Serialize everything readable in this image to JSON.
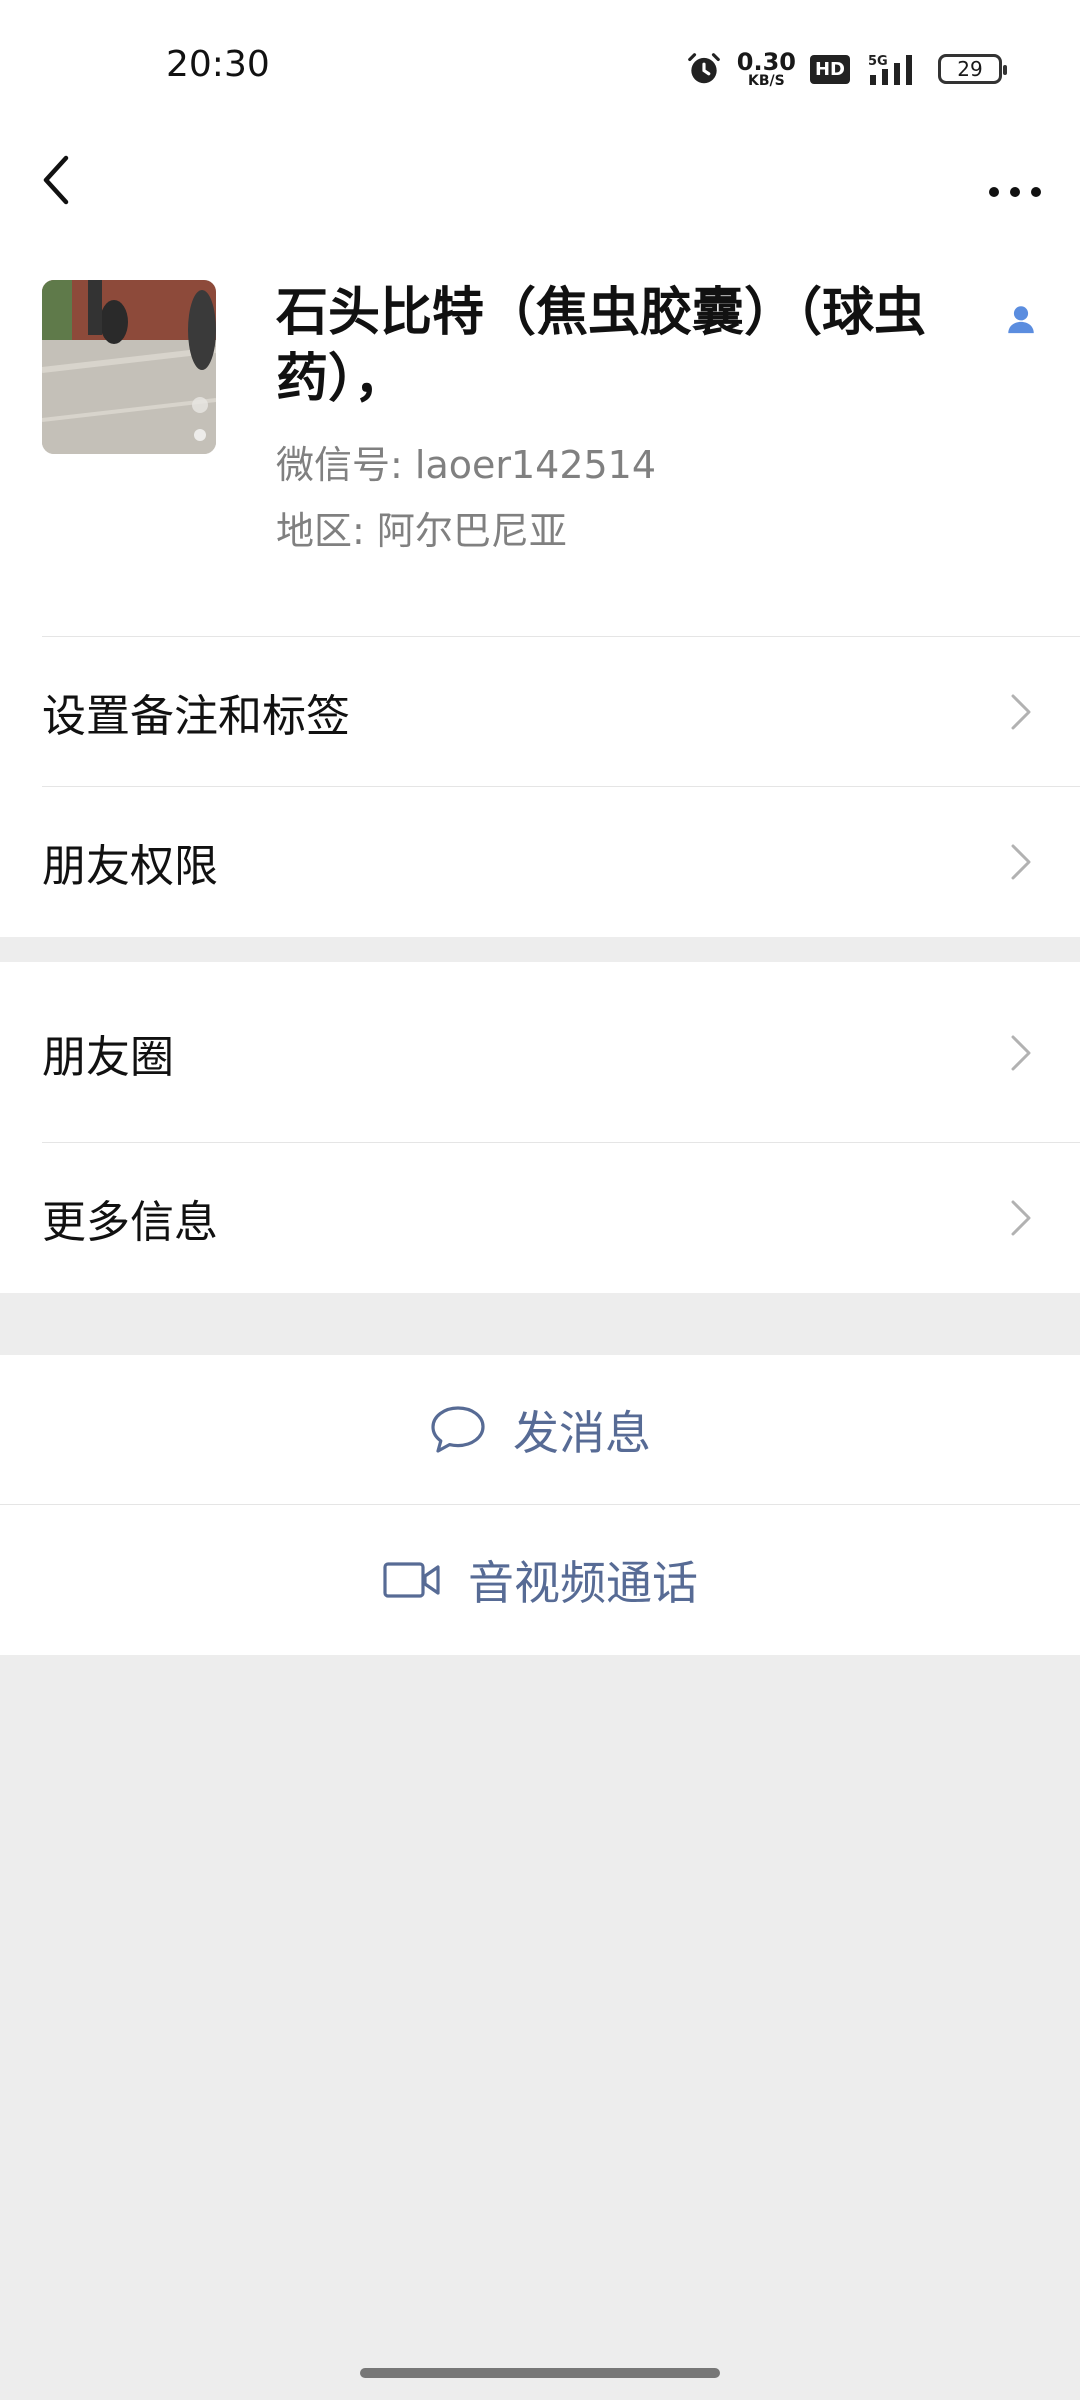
{
  "status_bar": {
    "time": "20:30",
    "net_speed_value": "0.30",
    "net_speed_unit": "KB/S",
    "hd": "HD",
    "network": "5G",
    "battery": "29"
  },
  "profile": {
    "name": "石头比特（焦虫胶囊）（球虫药），",
    "wechat_id": "微信号: laoer142514",
    "region": "地区: 阿尔巴尼亚"
  },
  "menu": {
    "remarks_tags": "设置备注和标签",
    "friend_permissions": "朋友权限",
    "moments": "朋友圈",
    "more_info": "更多信息"
  },
  "actions": {
    "send_message": "发消息",
    "av_call": "音视频通话"
  },
  "colors": {
    "link_blue": "#576b95",
    "background": "#ededed",
    "surface": "#ffffff"
  }
}
